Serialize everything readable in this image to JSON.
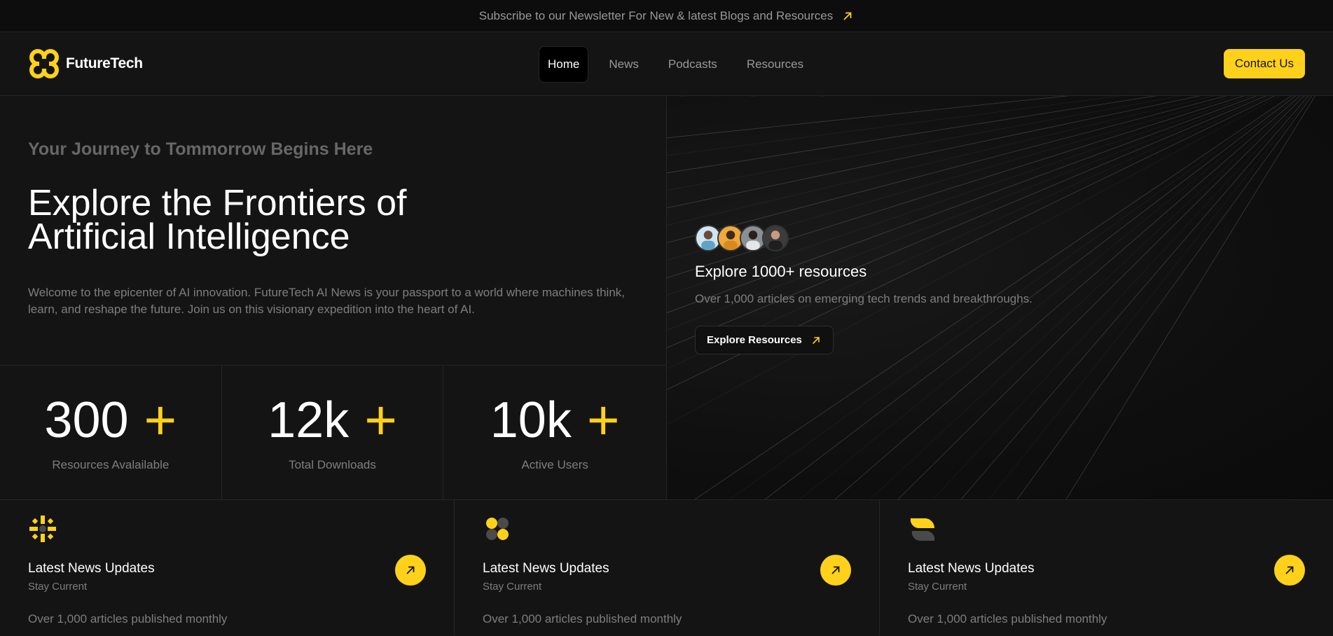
{
  "banner": {
    "text": "Subscribe to our Newsletter For New & latest Blogs and Resources",
    "icon": "arrow-up-right-icon"
  },
  "header": {
    "brand": "FutureTech",
    "nav": [
      {
        "label": "Home",
        "active": true
      },
      {
        "label": "News",
        "active": false
      },
      {
        "label": "Podcasts",
        "active": false
      },
      {
        "label": "Resources",
        "active": false
      }
    ],
    "contact_label": "Contact Us"
  },
  "hero": {
    "eyebrow": "Your Journey to Tommorrow Begins Here",
    "title": "Explore the Frontiers of Artificial Intelligence",
    "description": "Welcome to the epicenter of AI innovation. FutureTech AI News is your passport to a world where machines think, learn, and reshape the future. Join us on this visionary expedition into the heart of AI.",
    "stats": [
      {
        "number": "300",
        "plus": "+",
        "label": "Resources Avalailable"
      },
      {
        "number": "12k",
        "plus": "+",
        "label": "Total Downloads"
      },
      {
        "number": "10k",
        "plus": "+",
        "label": "Active Users"
      }
    ],
    "resources": {
      "title": "Explore 1000+ resources",
      "subtitle": "Over 1,000 articles on emerging tech trends and breakthroughs.",
      "button_label": "Explore Resources"
    }
  },
  "features": [
    {
      "icon": "sparkle-icon",
      "title": "Latest News Updates",
      "subtitle": "Stay Current",
      "description": "Over 1,000 articles published monthly"
    },
    {
      "icon": "flower-icon",
      "title": "Latest News Updates",
      "subtitle": "Stay Current",
      "description": "Over 1,000 articles published monthly"
    },
    {
      "icon": "leaf-icon",
      "title": "Latest News Updates",
      "subtitle": "Stay Current",
      "description": "Over 1,000 articles published monthly"
    }
  ],
  "colors": {
    "accent": "#ffd11a",
    "background": "#141414",
    "border": "#262626",
    "muted_text": "#7e7e81"
  }
}
